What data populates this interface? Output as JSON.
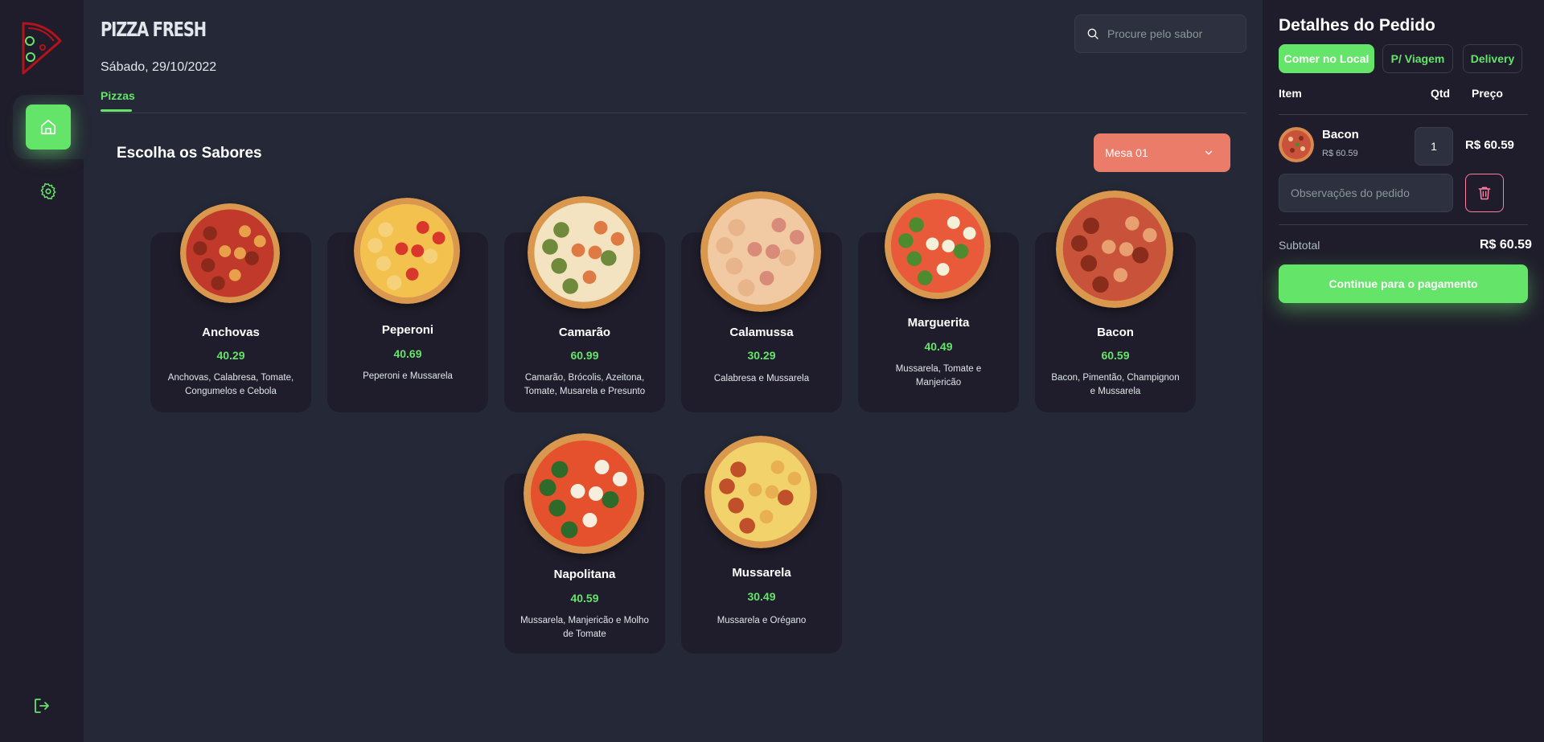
{
  "brand": "PIZZA FRESH",
  "date": "Sábado, 29/10/2022",
  "tabs": [
    {
      "label": "Pizzas",
      "active": true
    }
  ],
  "search": {
    "placeholder": "Procure pelo sabor"
  },
  "main": {
    "title": "Escolha os Sabores",
    "table_select": "Mesa 01"
  },
  "products": [
    {
      "name": "Anchovas",
      "price": "40.29",
      "description": "Anchovas, Calabresa, Tomate, Congumelos e Cebola",
      "colors": [
        "#c0392b",
        "#e8a04a",
        "#8b2a1a"
      ]
    },
    {
      "name": "Peperoni",
      "price": "40.69",
      "description": "Peperoni e Mussarela",
      "colors": [
        "#f2c14e",
        "#d9372b",
        "#f5d27a"
      ]
    },
    {
      "name": "Camarão",
      "price": "60.99",
      "description": "Camarão, Brócolis, Azeitona, Tomate, Musarela e Presunto",
      "colors": [
        "#f4e3c0",
        "#e07a44",
        "#6e8a3a"
      ]
    },
    {
      "name": "Calamussa",
      "price": "30.29",
      "description": "Calabresa e Mussarela",
      "colors": [
        "#f1c9a2",
        "#d98b7a",
        "#e8b48a"
      ]
    },
    {
      "name": "Marguerita",
      "price": "40.49",
      "description": "Mussarela, Tomate e Manjericão",
      "colors": [
        "#e85a3a",
        "#f5f0d8",
        "#4e8a2e"
      ]
    },
    {
      "name": "Bacon",
      "price": "60.59",
      "description": "Bacon, Pimentão, Champignon e Mussarela",
      "colors": [
        "#c8523a",
        "#e8a070",
        "#8a2c1c"
      ]
    },
    {
      "name": "Napolitana",
      "price": "40.59",
      "description": "Mussarela, Manjericão e Molho de Tomate",
      "colors": [
        "#e4512c",
        "#f6efe0",
        "#2e6a2a"
      ]
    },
    {
      "name": "Mussarela",
      "price": "30.49",
      "description": "Mussarela e Orégano",
      "colors": [
        "#f2d26a",
        "#e8b050",
        "#c0502a"
      ]
    }
  ],
  "order": {
    "title": "Detalhes do Pedido",
    "options": [
      {
        "label": "Comer no Local",
        "active": true
      },
      {
        "label": "P/ Viagem",
        "active": false
      },
      {
        "label": "Delivery",
        "active": false
      }
    ],
    "columns": {
      "item": "Item",
      "qty": "Qtd",
      "price": "Preço"
    },
    "items": [
      {
        "name": "Bacon",
        "unit_price": "R$ 60.59",
        "qty": "1",
        "total": "R$ 60.59"
      }
    ],
    "notes_placeholder": "Observações do pedido",
    "subtotal_label": "Subtotal",
    "subtotal_value": "R$ 60.59",
    "pay_label": "Continue para o pagamento"
  },
  "accent_color": "#65e46a",
  "alert_color": "#ea7c69"
}
